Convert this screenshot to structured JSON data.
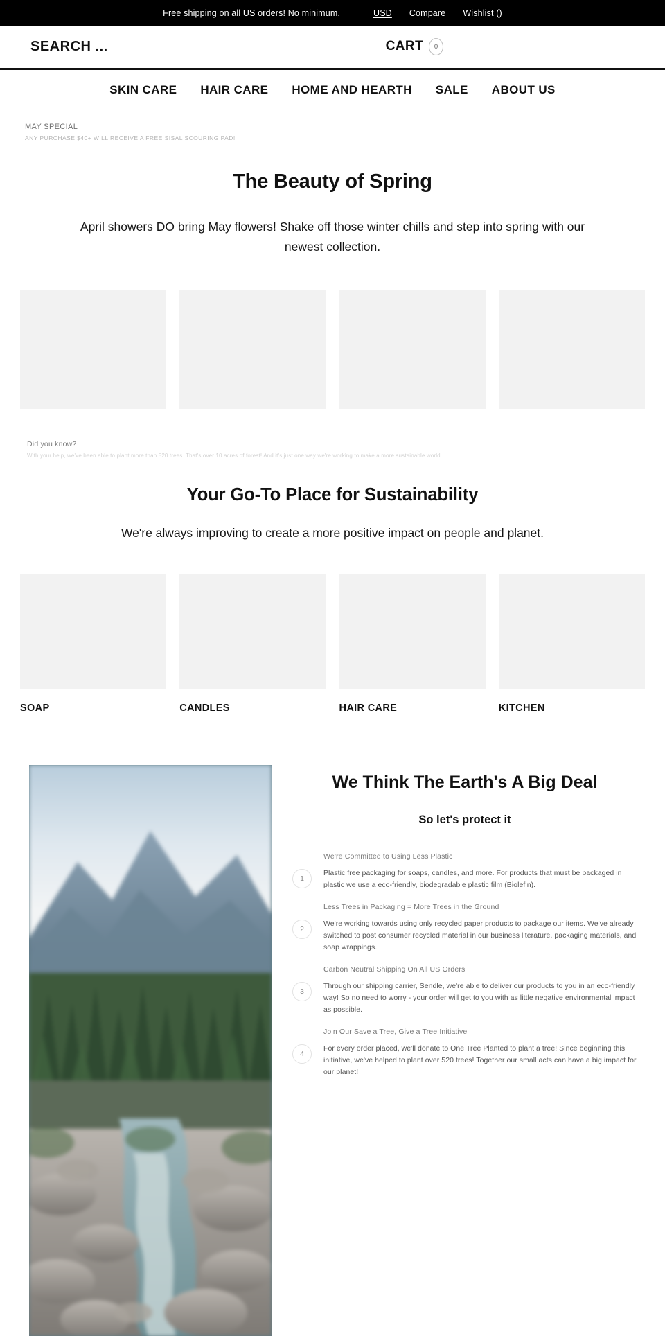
{
  "topbar": {
    "message": "Free shipping on all US orders! No minimum.",
    "links": [
      {
        "label": "USD",
        "name": "currency-selector"
      },
      {
        "label": "Compare",
        "name": "compare-link"
      },
      {
        "label": "Wishlist ()",
        "name": "wishlist-link"
      }
    ]
  },
  "header": {
    "search_placeholder": "SEARCH ...",
    "search_value": "",
    "cart_label": "CART",
    "cart_count": "0"
  },
  "nav": {
    "items": [
      {
        "label": "SKIN CARE"
      },
      {
        "label": "HAIR CARE"
      },
      {
        "label": "HOME AND HEARTH"
      },
      {
        "label": "SALE"
      },
      {
        "label": "ABOUT US"
      }
    ]
  },
  "promo": {
    "title": "MAY SPECIAL",
    "subtitle": "ANY PURCHASE $40+ WILL RECEIVE A FREE SISAL SCOURING PAD!"
  },
  "hero": {
    "heading": "The Beauty of Spring",
    "paragraph": "April showers DO bring May flowers! Shake off those winter chills and step into spring with our newest collection."
  },
  "fact": {
    "title": "Did you know?",
    "text": "With your help, we've been able to plant more than 520 trees. That's over 10 acres of forest! And it's just one way we're working to make a more sustainable world."
  },
  "sustainability": {
    "heading": "Your Go-To Place for Sustainability",
    "subheading": "We're always improving to create a more positive impact on people and planet."
  },
  "categories": [
    {
      "label": "SOAP"
    },
    {
      "label": "CANDLES"
    },
    {
      "label": "HAIR CARE"
    },
    {
      "label": "KITCHEN"
    }
  ],
  "earth": {
    "heading": "We Think The Earth's A Big Deal",
    "subheading": "So let's protect it",
    "steps": [
      {
        "number": "1",
        "title": "We're Committed to Using Less Plastic",
        "description": "Plastic free packaging for soaps, candles, and more. For products that must be packaged in plastic we use a eco-friendly, biodegradable plastic film (Biolefin)."
      },
      {
        "number": "2",
        "title": "Less Trees in Packaging = More Trees in the Ground",
        "description": "We're working towards using only recycled paper products to package our items. We've already switched to post consumer recycled material in our business literature, packaging materials, and soap wrappings."
      },
      {
        "number": "3",
        "title": "Carbon Neutral Shipping On All US Orders",
        "description": "Through our shipping carrier, Sendle, we're able to deliver our products to you in an eco-friendly way! So no need to worry - your order will get to you with as little negative environmental impact as possible."
      },
      {
        "number": "4",
        "title": "Join Our Save a Tree, Give a Tree Initiative",
        "description": "For every order placed, we'll donate to One Tree Planted to plant a tree! Since beginning this initiative, we've helped to plant over 520 trees! Together our small acts can have a big impact for our planet!"
      }
    ]
  },
  "colors": {
    "topbar_bg": "#000000",
    "text": "#111111",
    "placeholder_tile": "#f2f2f2",
    "muted": "#767676"
  }
}
